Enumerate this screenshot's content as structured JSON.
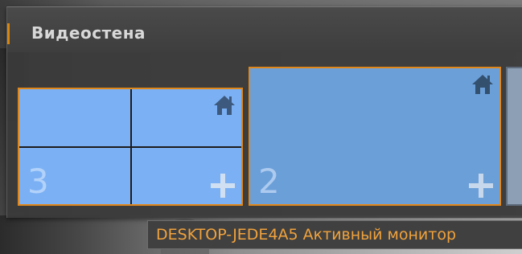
{
  "panel": {
    "title": "Видеостена"
  },
  "monitors": [
    {
      "number": "3",
      "layout": "2x2 grid",
      "status": "idle"
    },
    {
      "number": "2",
      "layout": "single",
      "status": "active"
    }
  ],
  "tooltip": {
    "text": "DESKTOP-JEDE4A5 Активный монитор"
  },
  "colors": {
    "accent": "#e0871c",
    "tooltip_text": "#f0a23c",
    "monitor_idle": "#7bb1f4",
    "monitor_active": "#6b9fd8"
  },
  "icons": [
    "home-icon",
    "plus-icon"
  ]
}
